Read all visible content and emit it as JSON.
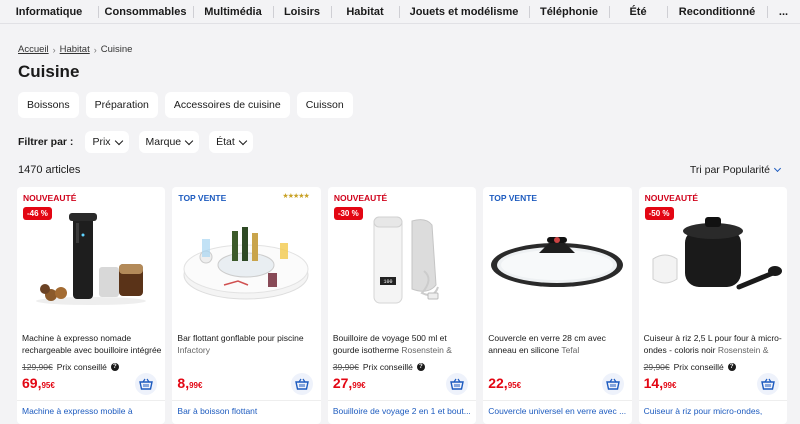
{
  "nav": [
    "Informatique",
    "Consommables",
    "Multimédia",
    "Loisirs",
    "Habitat",
    "Jouets et modélisme",
    "Téléphonie",
    "Été",
    "Reconditionné",
    "..."
  ],
  "breadcrumb": {
    "home": "Accueil",
    "parent": "Habitat",
    "current": "Cuisine"
  },
  "page_title": "Cuisine",
  "categories": [
    "Boissons",
    "Préparation",
    "Accessoires de cuisine",
    "Cuisson"
  ],
  "filters": {
    "label": "Filtrer par :",
    "options": [
      "Prix",
      "Marque",
      "État"
    ]
  },
  "results": {
    "count": "1470 articles",
    "sort": "Tri par Popularité"
  },
  "colors": {
    "sale": "#e30613",
    "accent": "#1d5bbf"
  },
  "products": [
    {
      "badge": "NOUVEAUTÉ",
      "discount": "-46 %",
      "title": "Machine à expresso nomade rechargeable avec bouilloire intégrée",
      "brand": "",
      "old_price": "129,90€",
      "advice": "Prix conseillé",
      "price_main": "69,",
      "price_cents": "95€",
      "subtitle": "Machine à expresso mobile à"
    },
    {
      "badge": "TOP VENTE",
      "discount": "",
      "stars": "★★★★★",
      "title": "Bar flottant gonflable pour piscine",
      "brand": "Infactory",
      "old_price": "",
      "advice": "",
      "price_main": "8,",
      "price_cents": "99€",
      "subtitle": "Bar à boisson flottant"
    },
    {
      "badge": "NOUVEAUTÉ",
      "discount": "-30 %",
      "title": "Bouilloire de voyage 500 ml et gourde isotherme",
      "brand": "Rosenstein &",
      "old_price": "39,90€",
      "advice": "Prix conseillé",
      "price_main": "27,",
      "price_cents": "99€",
      "subtitle": "Bouilloire de voyage 2 en 1 et bout..."
    },
    {
      "badge": "TOP VENTE",
      "discount": "",
      "title": "Couvercle en verre 28 cm avec anneau en silicone",
      "brand": "Tefal",
      "old_price": "",
      "advice": "",
      "price_main": "22,",
      "price_cents": "95€",
      "subtitle": "Couvercle universel en verre avec ..."
    },
    {
      "badge": "NOUVEAUTÉ",
      "discount": "-50 %",
      "title": "Cuiseur à riz 2,5 L pour four à micro-ondes - coloris noir",
      "brand": "Rosenstein &",
      "old_price": "29,90€",
      "advice": "Prix conseillé",
      "price_main": "14,",
      "price_cents": "99€",
      "subtitle": "Cuiseur à riz pour micro-ondes,"
    }
  ]
}
